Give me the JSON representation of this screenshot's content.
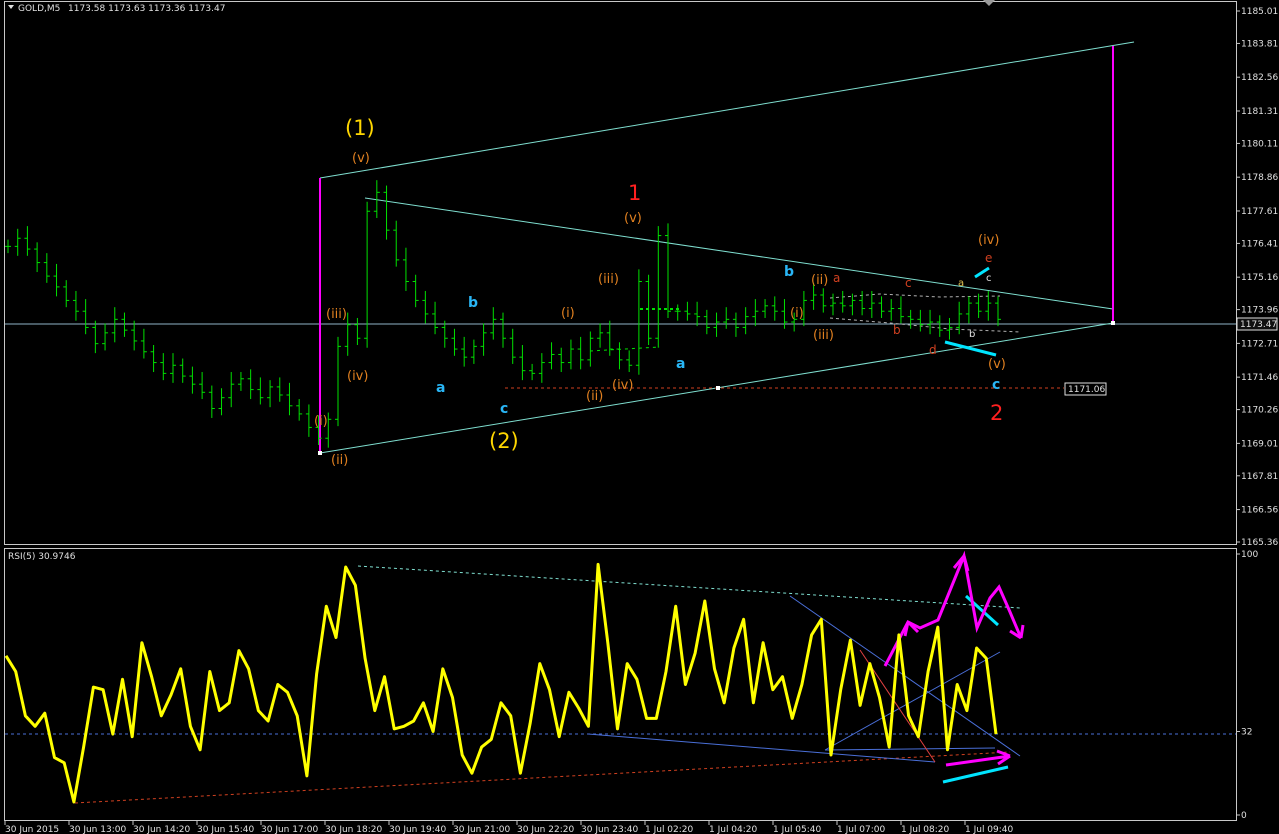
{
  "header": {
    "symbol_label": "GOLD,M5",
    "ohlc_label": "1173.58 1173.63 1173.36 1173.47",
    "indicator_label": "RSI(5) 30.9746"
  },
  "colors": {
    "background": "#000000",
    "candles": "#00e000",
    "rsi_line": "#ffff00",
    "channel": "#7fdfd0",
    "magenta": "#ff00ff",
    "wave_primary": "#ffd700",
    "wave_minor": "#e08020",
    "wave_abc": "#29b6f6",
    "wave_red": "#ff2020",
    "grid_text": "#e0e0e0"
  },
  "chart_data": [
    {
      "type": "candlestick",
      "symbol": "GOLD",
      "timeframe": "M5",
      "ylim": [
        1165.36,
        1185.01
      ],
      "y_ticks": [
        "1185.01",
        "1183.81",
        "1182.56",
        "1181.31",
        "1180.11",
        "1178.86",
        "1177.61",
        "1176.41",
        "1175.16",
        "1173.96",
        "1172.71",
        "1171.46",
        "1170.26",
        "1169.01",
        "1167.81",
        "1166.56",
        "1165.36"
      ],
      "x_ticks": [
        "30 Jun 2015",
        "30 Jun 13:00",
        "30 Jun 14:20",
        "30 Jun 15:40",
        "30 Jun 17:00",
        "30 Jun 18:20",
        "30 Jun 19:40",
        "30 Jun 21:00",
        "30 Jun 22:20",
        "30 Jun 23:40",
        "1 Jul 02:20",
        "1 Jul 04:20",
        "1 Jul 05:40",
        "1 Jul 07:00",
        "1 Jul 08:20",
        "1 Jul 09:40"
      ],
      "current_price": "1173.47",
      "reference_level": "1171.06",
      "close_series": [
        1176.3,
        1176.6,
        1176.2,
        1175.7,
        1175.2,
        1174.8,
        1174.3,
        1173.9,
        1173.3,
        1172.7,
        1173.1,
        1173.6,
        1173.2,
        1172.8,
        1172.4,
        1172.0,
        1171.6,
        1171.9,
        1171.5,
        1171.2,
        1170.9,
        1170.3,
        1170.7,
        1171.2,
        1171.4,
        1171.0,
        1170.7,
        1171.1,
        1170.8,
        1170.4,
        1170.1,
        1169.6,
        1169.2,
        1169.9,
        1172.6,
        1173.4,
        1172.9,
        1177.6,
        1178.3,
        1176.9,
        1175.8,
        1175.0,
        1174.3,
        1173.8,
        1173.3,
        1172.9,
        1172.5,
        1172.2,
        1172.6,
        1173.1,
        1173.6,
        1172.9,
        1172.2,
        1171.7,
        1171.6,
        1172.0,
        1172.3,
        1172.0,
        1172.5,
        1172.1,
        1172.9,
        1173.1,
        1172.5,
        1172.1,
        1171.9,
        1175.0,
        1172.9,
        1176.7,
        1173.9,
        1173.9,
        1173.8,
        1173.7,
        1173.3,
        1173.5,
        1173.6,
        1173.3,
        1173.7,
        1173.9,
        1174.1,
        1173.9,
        1173.5,
        1173.6,
        1174.3,
        1174.5,
        1174.1,
        1174.2,
        1174.1,
        1174.3,
        1174.0,
        1174.2,
        1173.9,
        1174.0,
        1173.7,
        1173.6,
        1173.4,
        1173.5,
        1173.2,
        1173.3,
        1173.8,
        1174.2,
        1173.9,
        1174.2,
        1173.6
      ]
    },
    {
      "type": "line",
      "name": "RSI(5) 30.9746",
      "ylim": [
        0,
        100
      ],
      "y_ticks": [
        "100",
        "32",
        "0"
      ],
      "level": 32,
      "values": [
        61,
        55,
        38,
        34,
        39,
        22,
        20,
        5,
        26,
        49,
        48,
        31,
        52,
        30,
        66,
        53,
        38,
        46,
        56,
        34,
        25,
        55,
        40,
        43,
        63,
        56,
        40,
        36,
        50,
        47,
        38,
        15,
        54,
        80,
        68,
        95,
        88,
        60,
        40,
        53,
        33,
        34,
        36,
        43,
        32,
        56,
        45,
        23,
        16,
        26,
        29,
        43,
        38,
        16,
        35,
        58,
        48,
        30,
        47,
        41,
        34,
        96,
        66,
        33,
        58,
        52,
        37,
        37,
        55,
        80,
        50,
        62,
        82,
        56,
        43,
        64,
        75,
        43,
        66,
        48,
        53,
        37,
        50,
        69,
        75,
        23,
        48,
        67,
        42,
        58,
        45,
        26,
        69,
        38,
        30,
        55,
        72,
        25,
        50,
        40,
        64,
        60,
        31
      ]
    }
  ],
  "annotations": {
    "w1_big": "(1)",
    "w2_big": "(2)",
    "red_1": "1",
    "red_2": "2",
    "v_top": "(v)",
    "iii_left": "(iii)",
    "iv_left": "(iv)",
    "i_left": "(i)",
    "ii_left": "(ii)",
    "a1": "a",
    "b1": "b",
    "c1": "c",
    "i_mid": "(i)",
    "iii_mid": "(iii)",
    "ii_mid": "(ii)",
    "iv_mid": "(iv)",
    "v_mid": "(v)",
    "a2": "a",
    "b2": "b",
    "i_r": "(i)",
    "ii_r": "(ii)",
    "iii_r": "(iii)",
    "a_r": "a",
    "b_r": "b",
    "c_r": "c",
    "d_r": "d",
    "e_r": "e",
    "iv_r": "(iv)",
    "v_r": "(v)",
    "a_s": "a",
    "b_s": "b",
    "c_s": "c",
    "c_final": "c"
  }
}
